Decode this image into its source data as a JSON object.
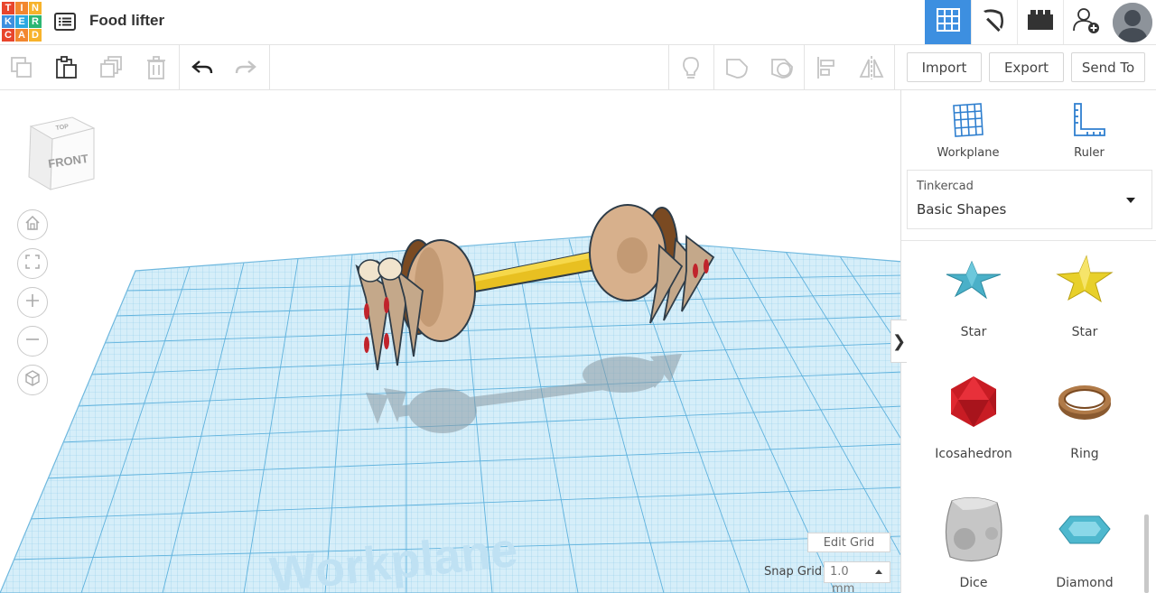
{
  "app": {
    "logo_letters": [
      "T",
      "I",
      "N",
      "K",
      "E",
      "R",
      "C",
      "A",
      "D"
    ],
    "logo_colors": [
      "#e8452c",
      "#f2872f",
      "#f7b32b",
      "#3d8fe0",
      "#29a8e0",
      "#2cb673",
      "#e8452c",
      "#f2872f",
      "#f7b32b"
    ],
    "design_title": "Food lifter",
    "accent_color": "#3d8fe0"
  },
  "topbar": {
    "icons": [
      "grid-view-icon",
      "pickaxe-icon",
      "bricks-icon",
      "add-user-icon"
    ],
    "avatar": "user-avatar"
  },
  "toolbar": {
    "icons": [
      "copy-icon",
      "paste-icon",
      "duplicate-icon",
      "delete-icon",
      "undo-icon",
      "redo-icon",
      "lightbulb-icon",
      "group-icon",
      "ungroup-icon",
      "align-icon",
      "mirror-icon"
    ],
    "import_label": "Import",
    "export_label": "Export",
    "send_to_label": "Send To"
  },
  "viewport": {
    "view_cube_top": "TOP",
    "view_cube_front": "FRONT",
    "nav_icons": [
      "home-icon",
      "fit-icon",
      "zoom-in-icon",
      "zoom-out-icon",
      "perspective-icon"
    ],
    "workplane_watermark": "Workplane",
    "edit_grid_label": "Edit Grid",
    "snap_grid_label": "Snap Grid",
    "snap_grid_value": "1.0",
    "snap_grid_unit": "mm",
    "collapse_icon": "❯"
  },
  "panel": {
    "workplane_label": "Workplane",
    "ruler_label": "Ruler",
    "library_source": "Tinkercad",
    "library_name": "Basic Shapes",
    "shapes": [
      {
        "label": "Star",
        "color": "#4ab0c8"
      },
      {
        "label": "Star",
        "color": "#e8d02a"
      },
      {
        "label": "Icosahedron",
        "color": "#d8202a"
      },
      {
        "label": "Ring",
        "color": "#9b6a3e"
      },
      {
        "label": "Dice",
        "color": "#c8c8c8"
      },
      {
        "label": "Diamond",
        "color": "#5cc4d8"
      }
    ]
  }
}
